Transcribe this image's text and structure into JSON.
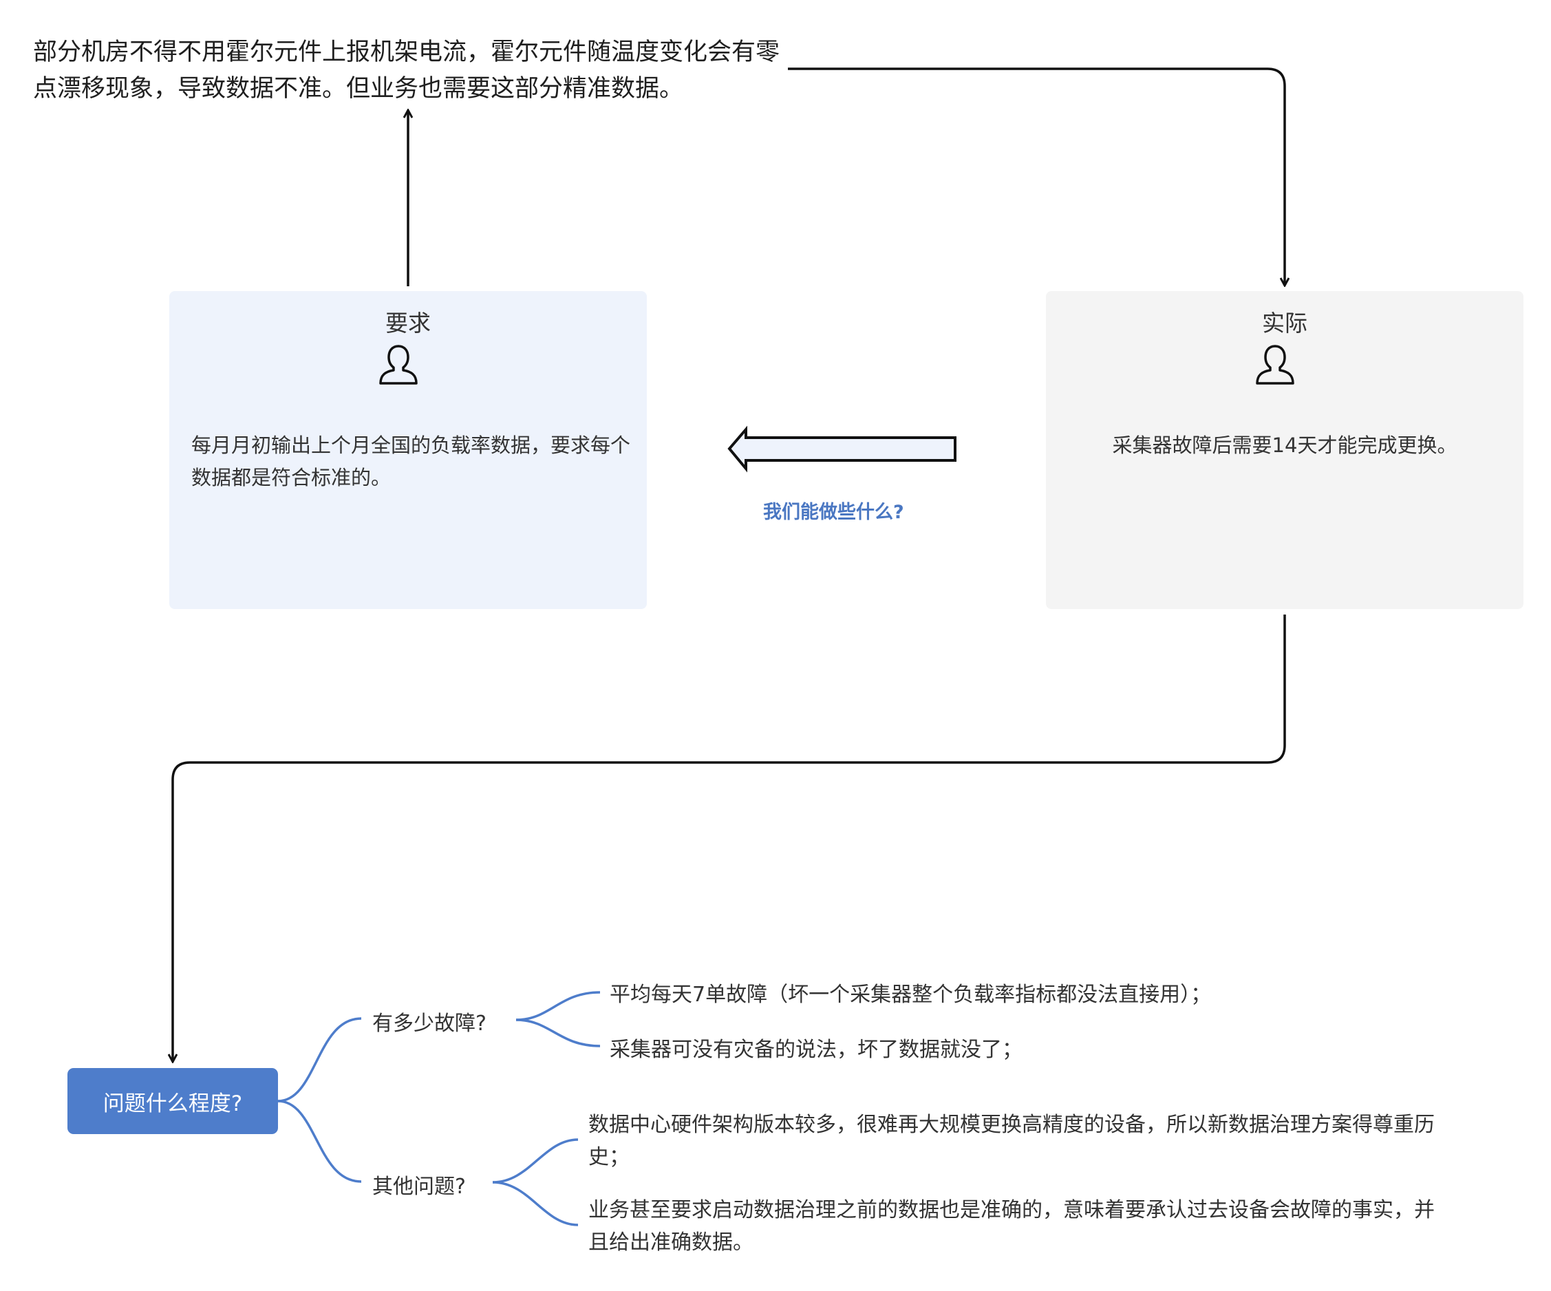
{
  "top_note": "部分机房不得不用霍尔元件上报机架电流，霍尔元件随温度变化会有零点漂移现象，导致数据不准。但业务也需要这部分精准数据。",
  "requirement": {
    "title": "要求",
    "icon": "user-icon",
    "body": "每月月初输出上个月全国的负载率数据，要求每个数据都是符合标准的。"
  },
  "actual": {
    "title": "实际",
    "icon": "user-icon",
    "body": "采集器故障后需要14天才能完成更换。"
  },
  "question": "我们能做些什么?",
  "mindmap": {
    "root": "问题什么程度?",
    "branches": [
      {
        "label": "有多少故障?",
        "leaves": [
          "平均每天7单故障（坏一个采集器整个负载率指标都没法直接用）；",
          "采集器可没有灾备的说法，坏了数据就没了；"
        ]
      },
      {
        "label": "其他问题?",
        "leaves": [
          "数据中心硬件架构版本较多，很难再大规模更换高精度的设备，所以新数据治理方案得尊重历史；",
          "业务甚至要求启动数据治理之前的数据也是准确的，意味着要承认过去设备会故障的事实，并且给出准确数据。"
        ]
      }
    ]
  },
  "colors": {
    "requirement_card": "#eef3fc",
    "actual_card": "#f4f4f4",
    "root_node": "#4e7dcb",
    "mindmap_lines": "#4e7dcb",
    "question_text": "#4a77c2",
    "connector": "#111111"
  }
}
